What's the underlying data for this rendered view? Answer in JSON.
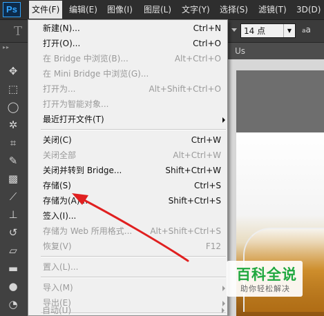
{
  "app": {
    "logo": "Ps"
  },
  "menubar": {
    "items": [
      {
        "label": "文件(F)",
        "active": true
      },
      {
        "label": "编辑(E)"
      },
      {
        "label": "图像(I)"
      },
      {
        "label": "图层(L)"
      },
      {
        "label": "文字(Y)"
      },
      {
        "label": "选择(S)"
      },
      {
        "label": "滤镜(T)"
      },
      {
        "label": "3D(D)"
      }
    ]
  },
  "options_bar": {
    "tool_icon": "T",
    "font_size": "14 点",
    "aa_icon": "a",
    "aa_icon_small": "a"
  },
  "document_tab": {
    "label": "Us"
  },
  "file_menu": {
    "items": [
      {
        "label": "新建(N)...",
        "shortcut": "Ctrl+N",
        "enabled": true
      },
      {
        "label": "打开(O)...",
        "shortcut": "Ctrl+O",
        "enabled": true
      },
      {
        "label": "在 Bridge 中浏览(B)...",
        "shortcut": "Alt+Ctrl+O",
        "enabled": false
      },
      {
        "label": "在 Mini Bridge 中浏览(G)...",
        "shortcut": "",
        "enabled": false
      },
      {
        "label": "打开为...",
        "shortcut": "Alt+Shift+Ctrl+O",
        "enabled": false
      },
      {
        "label": "打开为智能对象...",
        "shortcut": "",
        "enabled": false
      },
      {
        "label": "最近打开文件(T)",
        "shortcut": "",
        "enabled": true,
        "submenu": true
      },
      {
        "separator": true
      },
      {
        "label": "关闭(C)",
        "shortcut": "Ctrl+W",
        "enabled": true
      },
      {
        "label": "关闭全部",
        "shortcut": "Alt+Ctrl+W",
        "enabled": false
      },
      {
        "label": "关闭并转到 Bridge...",
        "shortcut": "Shift+Ctrl+W",
        "enabled": true
      },
      {
        "label": "存储(S)",
        "shortcut": "Ctrl+S",
        "enabled": true
      },
      {
        "label": "存储为(A)...",
        "shortcut": "Shift+Ctrl+S",
        "enabled": true
      },
      {
        "label": "签入(I)...",
        "shortcut": "",
        "enabled": true
      },
      {
        "label": "存储为 Web 所用格式...",
        "shortcut": "Alt+Shift+Ctrl+S",
        "enabled": false
      },
      {
        "label": "恢复(V)",
        "shortcut": "F12",
        "enabled": false
      },
      {
        "separator": true
      },
      {
        "label": "置入(L)...",
        "shortcut": "",
        "enabled": false
      },
      {
        "separator": true
      },
      {
        "label": "导入(M)",
        "shortcut": "",
        "enabled": false,
        "submenu": true
      },
      {
        "label": "导出(E)",
        "shortcut": "",
        "enabled": false,
        "submenu": true
      },
      {
        "separator": true
      },
      {
        "label": "自动(U)",
        "shortcut": "",
        "enabled": false,
        "submenu": true
      }
    ]
  },
  "watermark": {
    "title": "百科全说",
    "subtitle": "助你轻松解决"
  },
  "colors": {
    "annotation_arrow": "#e02020",
    "menu_bg": "#f0f0f0",
    "menubar_bg": "#2e2e2e",
    "watermark_green": "#1fa83f"
  }
}
